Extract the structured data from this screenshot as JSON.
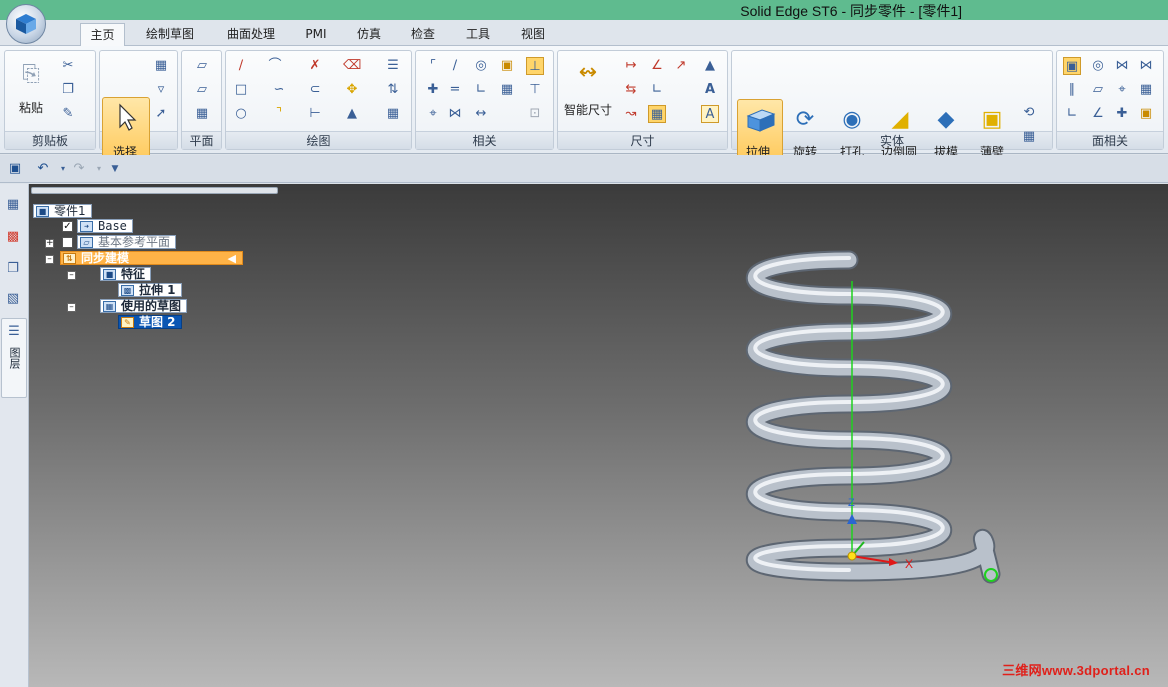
{
  "window": {
    "title": "Solid Edge ST6 - 同步零件 - [零件1]"
  },
  "tabs": [
    "主页",
    "绘制草图",
    "曲面处理",
    "PMI",
    "仿真",
    "检查",
    "工具",
    "视图"
  ],
  "active_tab": "主页",
  "ribbon": {
    "groups": {
      "clipboard": "剪贴板",
      "select": "选择",
      "plane": "平面",
      "draw": "绘图",
      "relate": "相关",
      "dimension": "尺寸",
      "solids": "实体",
      "face_relate": "面相关"
    },
    "buttons": {
      "paste": "粘贴",
      "select": "选择",
      "smart_dimension": "智能尺寸",
      "extrude": "拉伸",
      "revolve": "旋转",
      "hole": "打孔",
      "round": "边倒圆",
      "draft": "拔模",
      "thin_wall": "薄壁"
    }
  },
  "pathfinder": {
    "root": "零件1",
    "base": "Base",
    "ref_planes": "基本参考平面",
    "sync_modeling": "同步建模",
    "features": "特征",
    "extrude1": "拉伸 1",
    "used_sketches": "使用的草图",
    "sketch2": "草图 2"
  },
  "left_strip": {
    "layers_label": "图层"
  },
  "viewport": {
    "axis_labels": {
      "x": "X",
      "z": "Z"
    },
    "watermark": "三维网www.3dportal.cn"
  },
  "colors": {
    "title_bar": "#5fbb8f",
    "selection_highlight": "#ffc44d",
    "sync_node": "#ffb347",
    "selected_node": "#0b56b3",
    "spring": "#c4ccd6",
    "axis_x": "#e01818",
    "axis_z": "#1fd11f"
  }
}
